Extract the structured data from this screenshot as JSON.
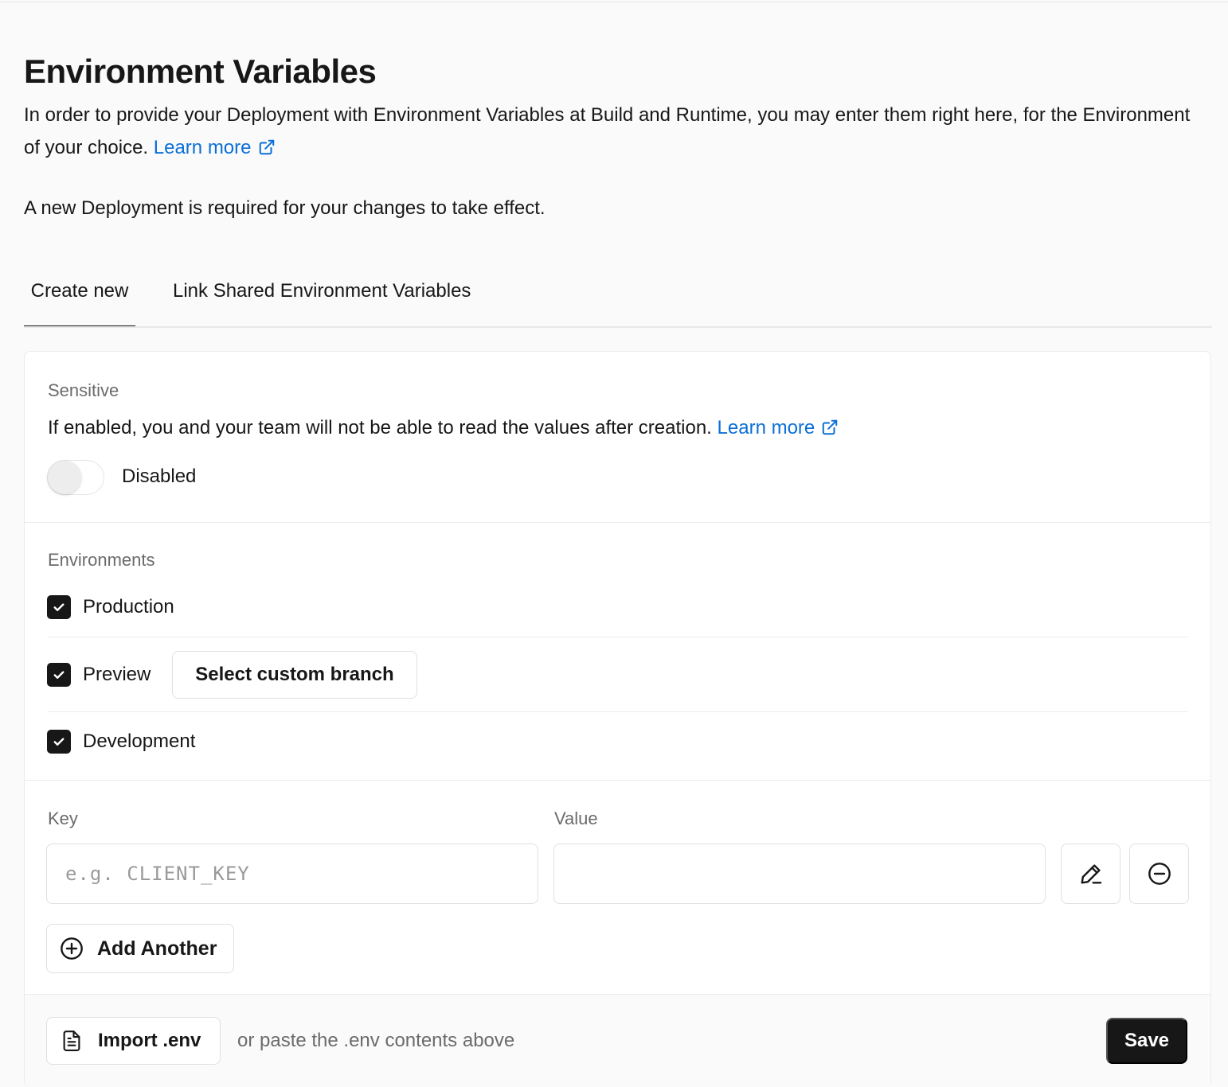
{
  "header": {
    "title": "Environment Variables",
    "description": "In order to provide your Deployment with Environment Variables at Build and Runtime, you may enter them right here, for the Environment of your choice.",
    "learn_more": "Learn more",
    "note": "A new Deployment is required for your changes to take effect."
  },
  "tabs": [
    {
      "label": "Create new",
      "active": true
    },
    {
      "label": "Link Shared Environment Variables",
      "active": false
    }
  ],
  "sensitive": {
    "label": "Sensitive",
    "description": "If enabled, you and your team will not be able to read the values after creation.",
    "learn_more": "Learn more",
    "toggle_state": "Disabled",
    "enabled": false
  },
  "environments": {
    "label": "Environments",
    "items": [
      {
        "label": "Production",
        "checked": true
      },
      {
        "label": "Preview",
        "checked": true
      },
      {
        "label": "Development",
        "checked": true
      }
    ],
    "custom_branch_button": "Select custom branch"
  },
  "key_value": {
    "key_label": "Key",
    "value_label": "Value",
    "key_placeholder": "e.g. CLIENT_KEY",
    "key_value": "",
    "value_value": "",
    "add_another": "Add Another"
  },
  "footer": {
    "import_button": "Import .env",
    "hint": "or paste the .env contents above",
    "save_button": "Save"
  },
  "colors": {
    "link": "#0a6fd8",
    "primary": "#171717",
    "background": "#fafafa"
  }
}
